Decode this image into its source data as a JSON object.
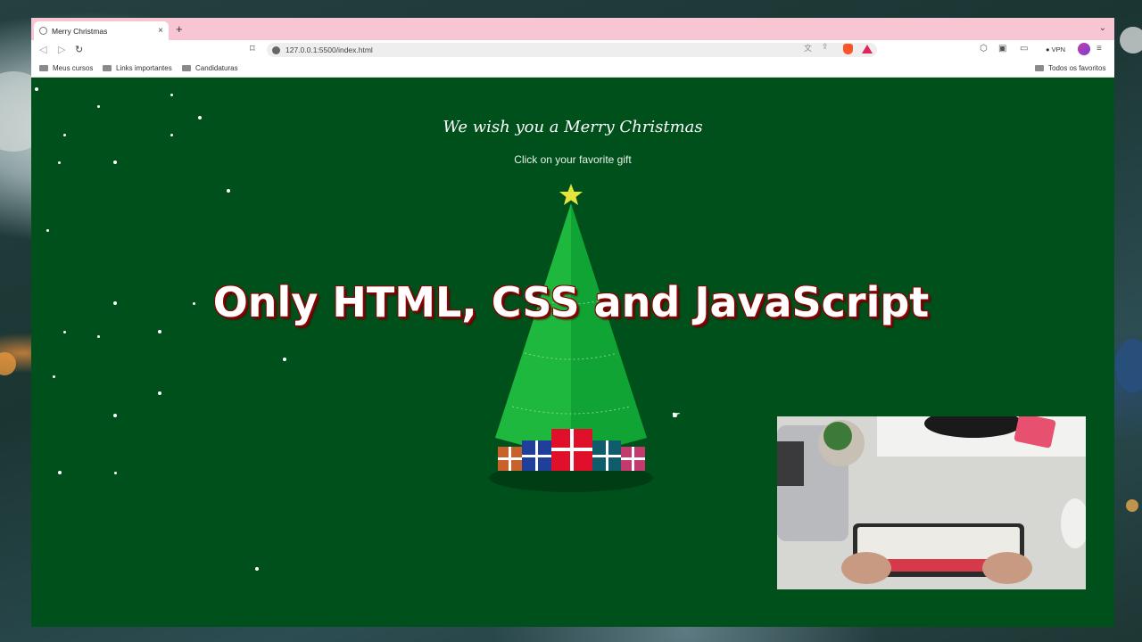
{
  "browser": {
    "tab_title": "Merry Christmas",
    "tab_close": "×",
    "new_tab": "+",
    "tab_menu": "⌄",
    "url": "127.0.0.1:5500/index.html",
    "vpn_label": "VPN",
    "bookmarks": [
      "Meus cursos",
      "Links importantes",
      "Candidaturas"
    ],
    "all_bookmarks": "Todos os favoritos"
  },
  "page": {
    "headline": "We wish you a Merry Christmas",
    "subtitle": "Click on your favorite gift"
  },
  "overlay": {
    "title": "Only HTML, CSS and JavaScript"
  },
  "colors": {
    "page_background": "#00501c",
    "tree_light": "#1fb83f",
    "tree_dark": "#0fa433",
    "star": "#e6e63a",
    "tab_strip": "#f7c6d2",
    "title_outline": "#8b0000"
  },
  "icons": [
    "favicon-globe-icon",
    "close-icon",
    "plus-icon",
    "back-icon",
    "forward-icon",
    "reload-icon",
    "bookmark-icon",
    "info-icon",
    "translate-icon",
    "share-icon",
    "brave-shield-icon",
    "brave-rewards-icon",
    "extensions-icon",
    "sidebar-icon",
    "wallet-icon",
    "profile-avatar",
    "menu-icon",
    "folder-icon",
    "cursor-icon"
  ]
}
